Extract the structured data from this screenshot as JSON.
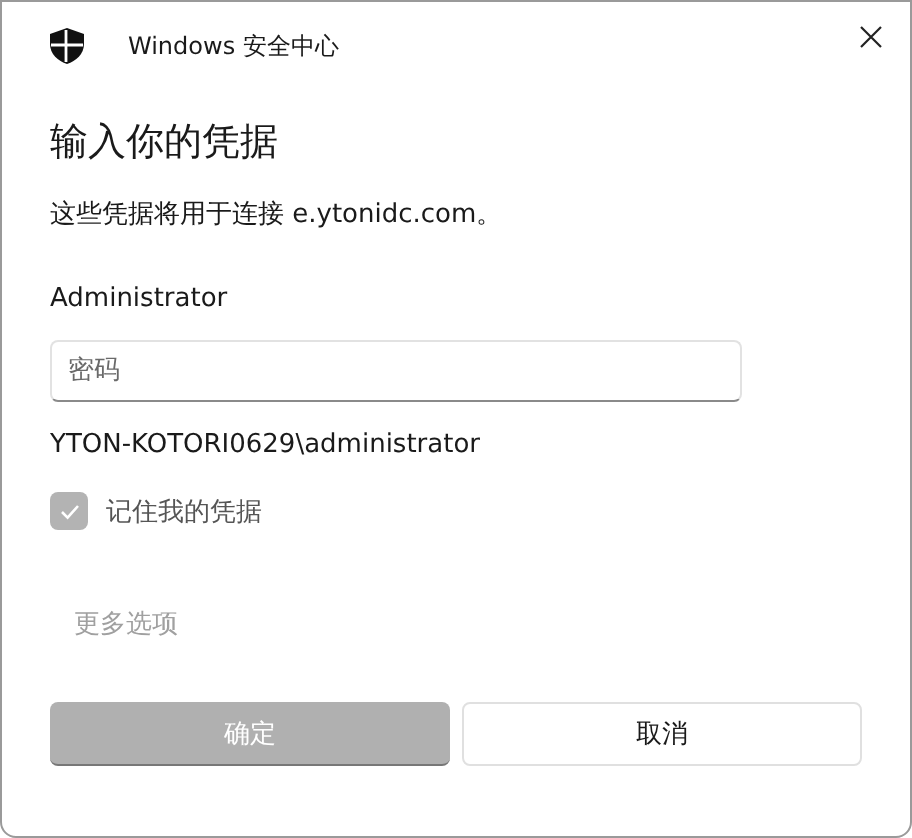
{
  "window": {
    "title": "Windows 安全中心"
  },
  "heading": "输入你的凭据",
  "description": "这些凭据将用于连接 e.ytonidc.com。",
  "username": "Administrator",
  "password_field": {
    "placeholder": "密码"
  },
  "domain_user": "YTON-KOTORI0629\\administrator",
  "remember": {
    "label": "记住我的凭据",
    "checked": true,
    "disabled": true
  },
  "more_options": {
    "label": "更多选项",
    "disabled": true
  },
  "buttons": [
    {
      "label": "确定",
      "kind": "primary",
      "disabled": true
    },
    {
      "label": "取消",
      "kind": "secondary",
      "disabled": false
    }
  ]
}
